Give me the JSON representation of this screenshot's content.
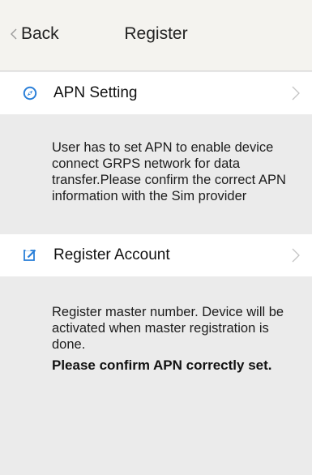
{
  "header": {
    "back_label": "Back",
    "title": "Register"
  },
  "apn_setting": {
    "label": "APN Setting",
    "icon": "compass-icon",
    "description": "User has to set APN to enable device connect GRPS network for data transfer.Please confirm the correct APN information with the Sim provider"
  },
  "register_account": {
    "label": "Register Account",
    "icon": "edit-icon",
    "description": "Register master number. Device will be activated when master registration is done.",
    "confirm_note": "Please confirm APN correctly set."
  },
  "colors": {
    "accent": "#2a7fd8",
    "header_bg": "#f4f3ef",
    "page_bg": "#ebebeb",
    "row_bg": "#ffffff"
  }
}
